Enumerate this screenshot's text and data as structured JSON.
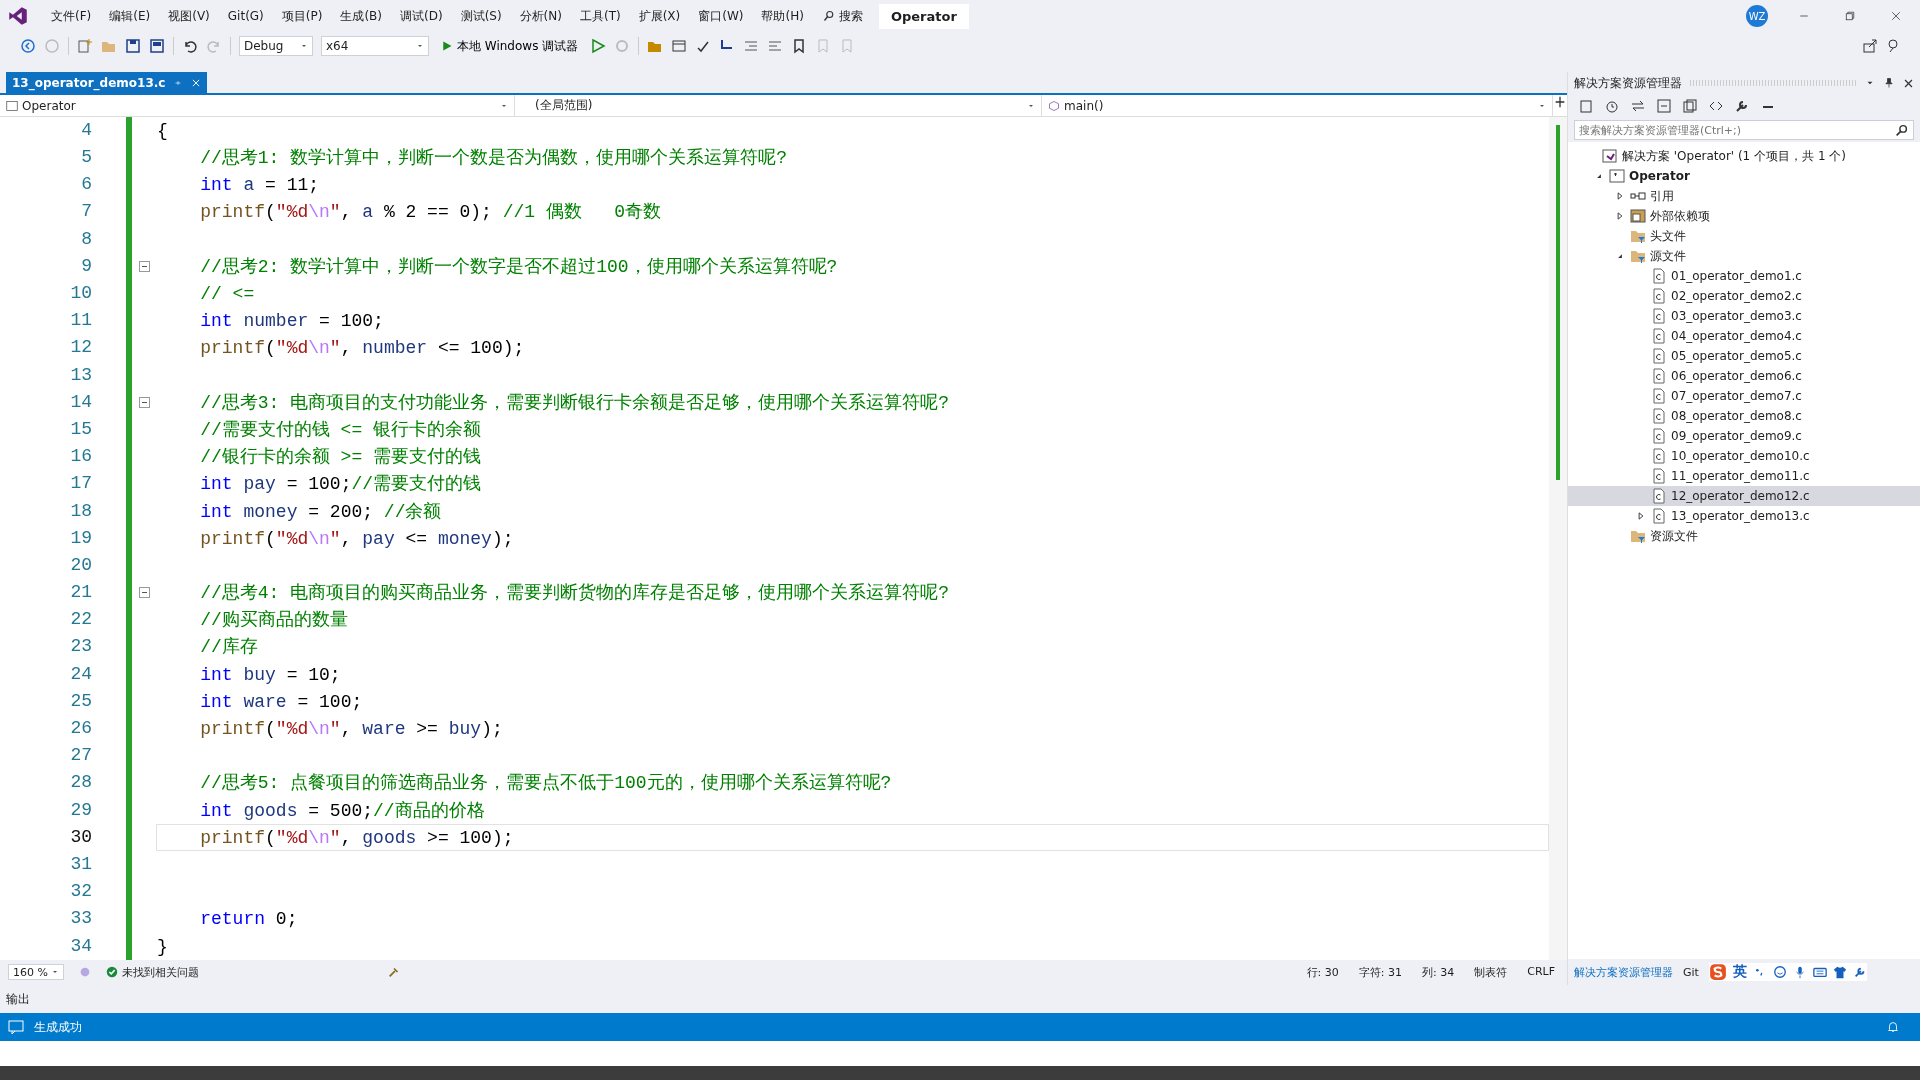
{
  "menu": [
    "文件(F)",
    "编辑(E)",
    "视图(V)",
    "Git(G)",
    "项目(P)",
    "生成(B)",
    "调试(D)",
    "测试(S)",
    "分析(N)",
    "工具(T)",
    "扩展(X)",
    "窗口(W)",
    "帮助(H)"
  ],
  "search": "搜索",
  "window": {
    "title": "Operator",
    "avatar": "WZ"
  },
  "toolbar": {
    "configuration": "Debug",
    "platform": "x64",
    "run": "本地 Windows 调试器"
  },
  "tabs": [
    {
      "label": "13_operator_demo13.c",
      "selected": true
    }
  ],
  "navbar": {
    "project": "Operator",
    "scope": "(全局范围)",
    "member": "main()"
  },
  "code": [
    {
      "n": "4",
      "current": false,
      "fold": false,
      "tokens": [
        {
          "kind": "plain",
          "text": "{"
        }
      ]
    },
    {
      "n": "5",
      "current": false,
      "fold": false,
      "tokens": [
        {
          "kind": "comment",
          "text": "    //思考1: 数学计算中，判断一个数是否为偶数，使用哪个关系运算符呢?"
        }
      ]
    },
    {
      "n": "6",
      "current": false,
      "fold": false,
      "tokens": [
        {
          "kind": "keyword",
          "text": "    int"
        },
        {
          "kind": "var",
          "text": " a"
        },
        {
          "kind": "plain",
          "text": " = 11;"
        }
      ]
    },
    {
      "n": "7",
      "current": false,
      "fold": false,
      "tokens": [
        {
          "kind": "func",
          "text": "    printf"
        },
        {
          "kind": "plain",
          "text": "("
        },
        {
          "kind": "string",
          "text": "\"%d"
        },
        {
          "kind": "escape",
          "text": "\\n"
        },
        {
          "kind": "string",
          "text": "\""
        },
        {
          "kind": "plain",
          "text": ","
        },
        {
          "kind": "var",
          "text": " a"
        },
        {
          "kind": "plain",
          "text": " % 2 == 0);"
        },
        {
          "kind": "comment",
          "text": " //1 偶数   0奇数"
        }
      ]
    },
    {
      "n": "8",
      "current": false,
      "fold": false
    },
    {
      "n": "9",
      "current": false,
      "fold": true,
      "tokens": [
        {
          "kind": "comment",
          "text": "    //思考2: 数学计算中，判断一个数字是否不超过100，使用哪个关系运算符呢?"
        }
      ]
    },
    {
      "n": "10",
      "current": false,
      "fold": false,
      "tokens": [
        {
          "kind": "comment",
          "text": "    // <="
        }
      ]
    },
    {
      "n": "11",
      "current": false,
      "fold": false,
      "tokens": [
        {
          "kind": "keyword",
          "text": "    int"
        },
        {
          "kind": "var",
          "text": " number"
        },
        {
          "kind": "plain",
          "text": " = 100;"
        }
      ]
    },
    {
      "n": "12",
      "current": false,
      "fold": false,
      "tokens": [
        {
          "kind": "func",
          "text": "    printf"
        },
        {
          "kind": "plain",
          "text": "("
        },
        {
          "kind": "string",
          "text": "\"%d"
        },
        {
          "kind": "escape",
          "text": "\\n"
        },
        {
          "kind": "string",
          "text": "\""
        },
        {
          "kind": "plain",
          "text": ","
        },
        {
          "kind": "var",
          "text": " number"
        },
        {
          "kind": "plain",
          "text": " <= 100);"
        }
      ]
    },
    {
      "n": "13",
      "current": false,
      "fold": false
    },
    {
      "n": "14",
      "current": false,
      "fold": true,
      "tokens": [
        {
          "kind": "comment",
          "text": "    //思考3: 电商项目的支付功能业务，需要判断银行卡余额是否足够，使用哪个关系运算符呢?"
        }
      ]
    },
    {
      "n": "15",
      "current": false,
      "fold": false,
      "tokens": [
        {
          "kind": "comment",
          "text": "    //需要支付的钱 <= 银行卡的余额"
        }
      ]
    },
    {
      "n": "16",
      "current": false,
      "fold": false,
      "tokens": [
        {
          "kind": "comment",
          "text": "    //银行卡的余额 >= 需要支付的钱"
        }
      ]
    },
    {
      "n": "17",
      "current": false,
      "fold": false,
      "tokens": [
        {
          "kind": "keyword",
          "text": "    int"
        },
        {
          "kind": "var",
          "text": " pay"
        },
        {
          "kind": "plain",
          "text": " = 100;"
        },
        {
          "kind": "comment",
          "text": "//需要支付的钱"
        }
      ]
    },
    {
      "n": "18",
      "current": false,
      "fold": false,
      "tokens": [
        {
          "kind": "keyword",
          "text": "    int"
        },
        {
          "kind": "var",
          "text": " money"
        },
        {
          "kind": "plain",
          "text": " = 200;"
        },
        {
          "kind": "comment",
          "text": " //余额"
        }
      ]
    },
    {
      "n": "19",
      "current": false,
      "fold": false,
      "tokens": [
        {
          "kind": "func",
          "text": "    printf"
        },
        {
          "kind": "plain",
          "text": "("
        },
        {
          "kind": "string",
          "text": "\"%d"
        },
        {
          "kind": "escape",
          "text": "\\n"
        },
        {
          "kind": "string",
          "text": "\""
        },
        {
          "kind": "plain",
          "text": ","
        },
        {
          "kind": "var",
          "text": " pay"
        },
        {
          "kind": "plain",
          "text": " <="
        },
        {
          "kind": "var",
          "text": " money"
        },
        {
          "kind": "plain",
          "text": ");"
        }
      ]
    },
    {
      "n": "20",
      "current": false,
      "fold": false
    },
    {
      "n": "21",
      "current": false,
      "fold": true,
      "tokens": [
        {
          "kind": "comment",
          "text": "    //思考4: 电商项目的购买商品业务，需要判断货物的库存是否足够，使用哪个关系运算符呢?"
        }
      ]
    },
    {
      "n": "22",
      "current": false,
      "fold": false,
      "tokens": [
        {
          "kind": "comment",
          "text": "    //购买商品的数量"
        }
      ]
    },
    {
      "n": "23",
      "current": false,
      "fold": false,
      "tokens": [
        {
          "kind": "comment",
          "text": "    //库存"
        }
      ]
    },
    {
      "n": "24",
      "current": false,
      "fold": false,
      "tokens": [
        {
          "kind": "keyword",
          "text": "    int"
        },
        {
          "kind": "var",
          "text": " buy"
        },
        {
          "kind": "plain",
          "text": " = 10;"
        }
      ]
    },
    {
      "n": "25",
      "current": false,
      "fold": false,
      "tokens": [
        {
          "kind": "keyword",
          "text": "    int"
        },
        {
          "kind": "var",
          "text": " ware"
        },
        {
          "kind": "plain",
          "text": " = 100;"
        }
      ]
    },
    {
      "n": "26",
      "current": false,
      "fold": false,
      "tokens": [
        {
          "kind": "func",
          "text": "    printf"
        },
        {
          "kind": "plain",
          "text": "("
        },
        {
          "kind": "string",
          "text": "\"%d"
        },
        {
          "kind": "escape",
          "text": "\\n"
        },
        {
          "kind": "string",
          "text": "\""
        },
        {
          "kind": "plain",
          "text": ","
        },
        {
          "kind": "var",
          "text": " ware"
        },
        {
          "kind": "plain",
          "text": " >="
        },
        {
          "kind": "var",
          "text": " buy"
        },
        {
          "kind": "plain",
          "text": ");"
        }
      ]
    },
    {
      "n": "27",
      "current": false,
      "fold": false
    },
    {
      "n": "28",
      "current": false,
      "fold": false,
      "tokens": [
        {
          "kind": "comment",
          "text": "    //思考5: 点餐项目的筛选商品业务，需要点不低于100元的，使用哪个关系运算符呢?"
        }
      ]
    },
    {
      "n": "29",
      "current": false,
      "fold": false,
      "tokens": [
        {
          "kind": "keyword",
          "text": "    int"
        },
        {
          "kind": "var",
          "text": " goods"
        },
        {
          "kind": "plain",
          "text": " = 500;"
        },
        {
          "kind": "comment",
          "text": "//商品的价格"
        }
      ]
    },
    {
      "n": "30",
      "current": true,
      "fold": false,
      "tokens": [
        {
          "kind": "func",
          "text": "    printf"
        },
        {
          "kind": "plain",
          "text": "("
        },
        {
          "kind": "string",
          "text": "\"%d"
        },
        {
          "kind": "escape",
          "text": "\\n"
        },
        {
          "kind": "string",
          "text": "\""
        },
        {
          "kind": "plain",
          "text": ","
        },
        {
          "kind": "var",
          "text": " goods"
        },
        {
          "kind": "plain",
          "text": " >= 100);"
        }
      ]
    },
    {
      "n": "31",
      "current": false,
      "fold": false
    },
    {
      "n": "32",
      "current": false,
      "fold": false
    },
    {
      "n": "33",
      "current": false,
      "fold": false,
      "tokens": [
        {
          "kind": "keyword",
          "text": "    return"
        },
        {
          "kind": "plain",
          "text": " 0;"
        }
      ]
    },
    {
      "n": "34",
      "current": false,
      "fold": false,
      "tokens": [
        {
          "kind": "plain",
          "text": "}"
        }
      ]
    }
  ],
  "editor_status": {
    "zoom": "160 %",
    "issues": "未找到相关问题",
    "line": "行: 30",
    "char": "字符: 31",
    "col": "列: 34",
    "indent": "制表符",
    "eol": "CRLF"
  },
  "solution_explorer": {
    "title": "解决方案资源管理器",
    "placeholder": "搜索解决方案资源管理器(Ctrl+;)",
    "tree": [
      {
        "label": "解决方案 'Operator' (1 个项目，共 1 个)",
        "kind": "solution",
        "selected": false,
        "children": [
          {
            "label": "Operator",
            "kind": "project",
            "expanded": true,
            "selected": false,
            "children": [
              {
                "label": "引用",
                "kind": "references",
                "expanded": false,
                "selected": false
              },
              {
                "label": "外部依赖项",
                "kind": "external",
                "expanded": false,
                "selected": false
              },
              {
                "label": "头文件",
                "kind": "filter",
                "selected": false
              },
              {
                "label": "源文件",
                "kind": "filter",
                "expanded": true,
                "selected": false,
                "children": [
                  {
                    "label": "01_operator_demo1.c",
                    "kind": "file",
                    "selected": false
                  },
                  {
                    "label": "02_operator_demo2.c",
                    "kind": "file",
                    "selected": false
                  },
                  {
                    "label": "03_operator_demo3.c",
                    "kind": "file",
                    "selected": false
                  },
                  {
                    "label": "04_operator_demo4.c",
                    "kind": "file",
                    "selected": false
                  },
                  {
                    "label": "05_operator_demo5.c",
                    "kind": "file",
                    "selected": false
                  },
                  {
                    "label": "06_operator_demo6.c",
                    "kind": "file",
                    "selected": false
                  },
                  {
                    "label": "07_operator_demo7.c",
                    "kind": "file",
                    "selected": false
                  },
                  {
                    "label": "08_operator_demo8.c",
                    "kind": "file",
                    "selected": false
                  },
                  {
                    "label": "09_operator_demo9.c",
                    "kind": "file",
                    "selected": false
                  },
                  {
                    "label": "10_operator_demo10.c",
                    "kind": "file",
                    "selected": false
                  },
                  {
                    "label": "11_operator_demo11.c",
                    "kind": "file",
                    "selected": false
                  },
                  {
                    "label": "12_operator_demo12.c",
                    "kind": "file",
                    "selected": true
                  },
                  {
                    "label": "13_operator_demo13.c",
                    "kind": "file",
                    "expanded": false,
                    "selected": false
                  }
                ]
              },
              {
                "label": "资源文件",
                "kind": "filter",
                "selected": false
              }
            ]
          }
        ]
      }
    ],
    "bottom_tabs": [
      {
        "label": "解决方案资源管理器",
        "selected": true
      },
      {
        "label": "Git",
        "selected": false
      }
    ]
  },
  "ime": {
    "language": "英"
  },
  "output_label": "输出",
  "status_bar": {
    "message": "生成成功"
  }
}
